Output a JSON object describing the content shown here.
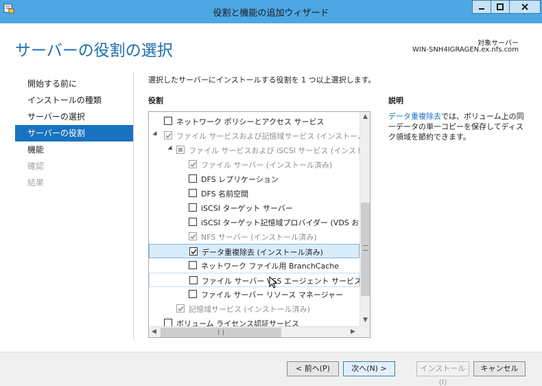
{
  "window": {
    "title": "役割と機能の追加ウィザード"
  },
  "header": {
    "page_title": "サーバーの役割の選択",
    "dest_label": "対象サーバー",
    "dest_server": "WIN-SNH4IGRAGEN.ex.nfs.com"
  },
  "nav": {
    "items": [
      {
        "label": "開始する前に",
        "state": "normal"
      },
      {
        "label": "インストールの種類",
        "state": "normal"
      },
      {
        "label": "サーバーの選択",
        "state": "normal"
      },
      {
        "label": "サーバーの役割",
        "state": "active"
      },
      {
        "label": "機能",
        "state": "normal"
      },
      {
        "label": "確認",
        "state": "disabled"
      },
      {
        "label": "結果",
        "state": "disabled"
      }
    ]
  },
  "main": {
    "instruction": "選択したサーバーにインストールする役割を 1 つ以上選択します。",
    "roles_header": "役割",
    "desc_header": "説明",
    "description_link": "データ重複除去",
    "description_text": "では、ボリューム上の同一データの単一コピーを保存してディスク領域を節約できます。"
  },
  "roles": [
    {
      "label": "ネットワーク ポリシーとアクセス サービス",
      "level": 1,
      "state": "unchecked",
      "expander": false,
      "gray": false
    },
    {
      "label": "ファイル サービスおよび記憶域サービス (インストール済み",
      "level": 1,
      "state": "checked",
      "expander": true,
      "gray": true
    },
    {
      "label": "ファイル サービスおよび iSCSI サービス (インストール",
      "level": 2,
      "state": "indeterminate",
      "expander": true,
      "gray": true
    },
    {
      "label": "ファイル サーバー (インストール済み)",
      "level": 3,
      "state": "checked",
      "expander": false,
      "gray": true
    },
    {
      "label": "DFS レプリケーション",
      "level": 3,
      "state": "unchecked",
      "expander": false,
      "gray": false
    },
    {
      "label": "DFS 名前空間",
      "level": 3,
      "state": "unchecked",
      "expander": false,
      "gray": false
    },
    {
      "label": "iSCSI ターゲット サーバー",
      "level": 3,
      "state": "unchecked",
      "expander": false,
      "gray": false
    },
    {
      "label": "iSCSI ターゲット記憶域プロバイダー (VDS およ",
      "level": 3,
      "state": "unchecked",
      "expander": false,
      "gray": false
    },
    {
      "label": "NFS サーバー (インストール済み)",
      "level": 3,
      "state": "checked",
      "expander": false,
      "gray": true
    },
    {
      "label": "データ重複除去 (インストール済み)",
      "level": 3,
      "state": "checked",
      "expander": false,
      "gray": false,
      "selected": true
    },
    {
      "label": "ネットワーク ファイル用 BranchCache",
      "level": 3,
      "state": "unchecked",
      "expander": false,
      "gray": false
    },
    {
      "label": "ファイル サーバー VSS エージェント サービス",
      "level": 3,
      "state": "unchecked",
      "expander": false,
      "gray": false,
      "hovered": true
    },
    {
      "label": "ファイル サーバー リソース マネージャー",
      "level": 3,
      "state": "unchecked",
      "expander": false,
      "gray": false
    },
    {
      "label": "記憶域サービス (インストール済み)",
      "level": 2,
      "state": "checked",
      "expander": false,
      "gray": true
    },
    {
      "label": "ボリューム ライセンス認証サービス",
      "level": 1,
      "state": "unchecked",
      "expander": false,
      "gray": false
    }
  ],
  "buttons": {
    "prev": "< 前へ(P)",
    "next": "次へ(N) >",
    "install": "インストール(I)",
    "cancel": "キャンセル"
  },
  "colors": {
    "title_bar": "#4ca7e4",
    "accent": "#1972c0",
    "page_title": "#1b6fae"
  }
}
